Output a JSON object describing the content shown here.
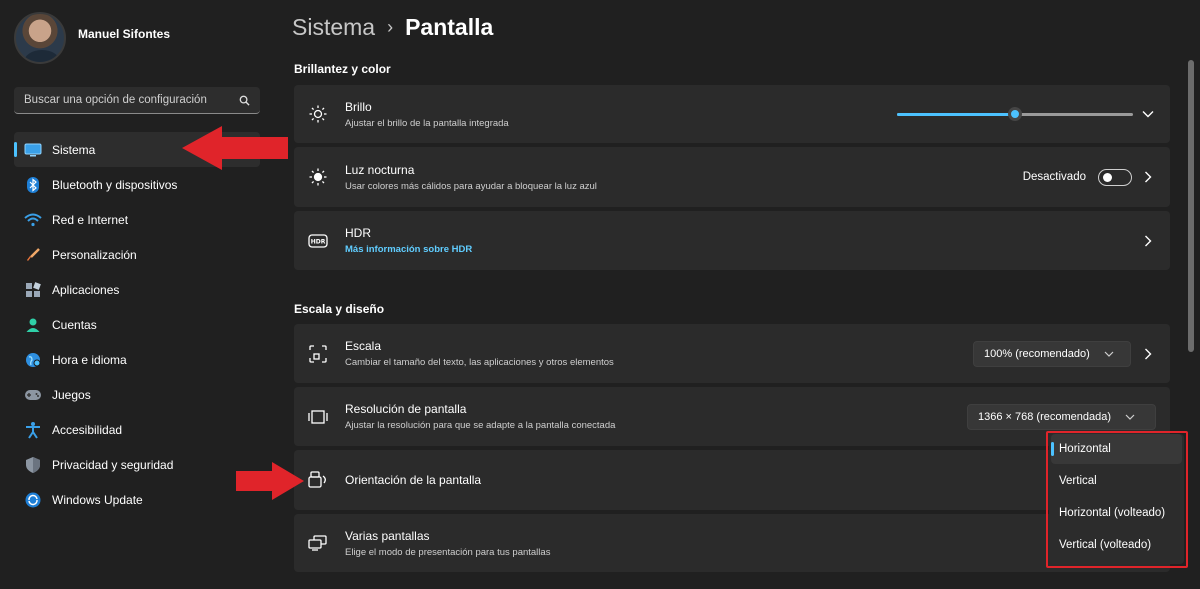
{
  "user": {
    "name": "Manuel Sifontes"
  },
  "search": {
    "placeholder": "Buscar una opción de configuración",
    "icon": "search-icon"
  },
  "sidebar": {
    "items": [
      {
        "label": "Sistema",
        "icon": "monitor-icon",
        "active": true
      },
      {
        "label": "Bluetooth y dispositivos",
        "icon": "bluetooth-icon"
      },
      {
        "label": "Red e Internet",
        "icon": "wifi-icon"
      },
      {
        "label": "Personalización",
        "icon": "brush-icon"
      },
      {
        "label": "Aplicaciones",
        "icon": "apps-icon"
      },
      {
        "label": "Cuentas",
        "icon": "person-icon"
      },
      {
        "label": "Hora e idioma",
        "icon": "globe-icon"
      },
      {
        "label": "Juegos",
        "icon": "gamepad-icon"
      },
      {
        "label": "Accesibilidad",
        "icon": "accessibility-icon"
      },
      {
        "label": "Privacidad y seguridad",
        "icon": "shield-icon"
      },
      {
        "label": "Windows Update",
        "icon": "update-icon"
      }
    ]
  },
  "breadcrumb": {
    "parent": "Sistema",
    "separator": "›",
    "current": "Pantalla"
  },
  "sections": {
    "brightness": "Brillantez y color",
    "scale_layout": "Escala y diseño"
  },
  "settings": {
    "brillo": {
      "title": "Brillo",
      "subtitle": "Ajustar el brillo de la pantalla integrada",
      "level": 0.5
    },
    "night_light": {
      "title": "Luz nocturna",
      "subtitle": "Usar colores más cálidos para ayudar a bloquear la luz azul",
      "state": "Desactivado"
    },
    "hdr": {
      "title": "HDR",
      "subtitle": "Más información sobre HDR"
    },
    "scale": {
      "title": "Escala",
      "subtitle": "Cambiar el tamaño del texto, las aplicaciones y otros elementos",
      "value": "100% (recomendado)"
    },
    "resolution": {
      "title": "Resolución de pantalla",
      "subtitle": "Ajustar la resolución para que se adapte a la pantalla conectada",
      "value": "1366 × 768 (recomendada)"
    },
    "orientation": {
      "title": "Orientación de la pantalla"
    },
    "multi": {
      "title": "Varias pantallas",
      "subtitle": "Elige el modo de presentación para tus pantallas"
    }
  },
  "orientation_menu": {
    "options": [
      "Horizontal",
      "Vertical",
      "Horizontal (volteado)",
      "Vertical (volteado)"
    ],
    "selected": "Horizontal"
  },
  "colors": {
    "accent": "#4cc2ff",
    "annotation_red": "#e0242a",
    "link": "#60cdff"
  }
}
